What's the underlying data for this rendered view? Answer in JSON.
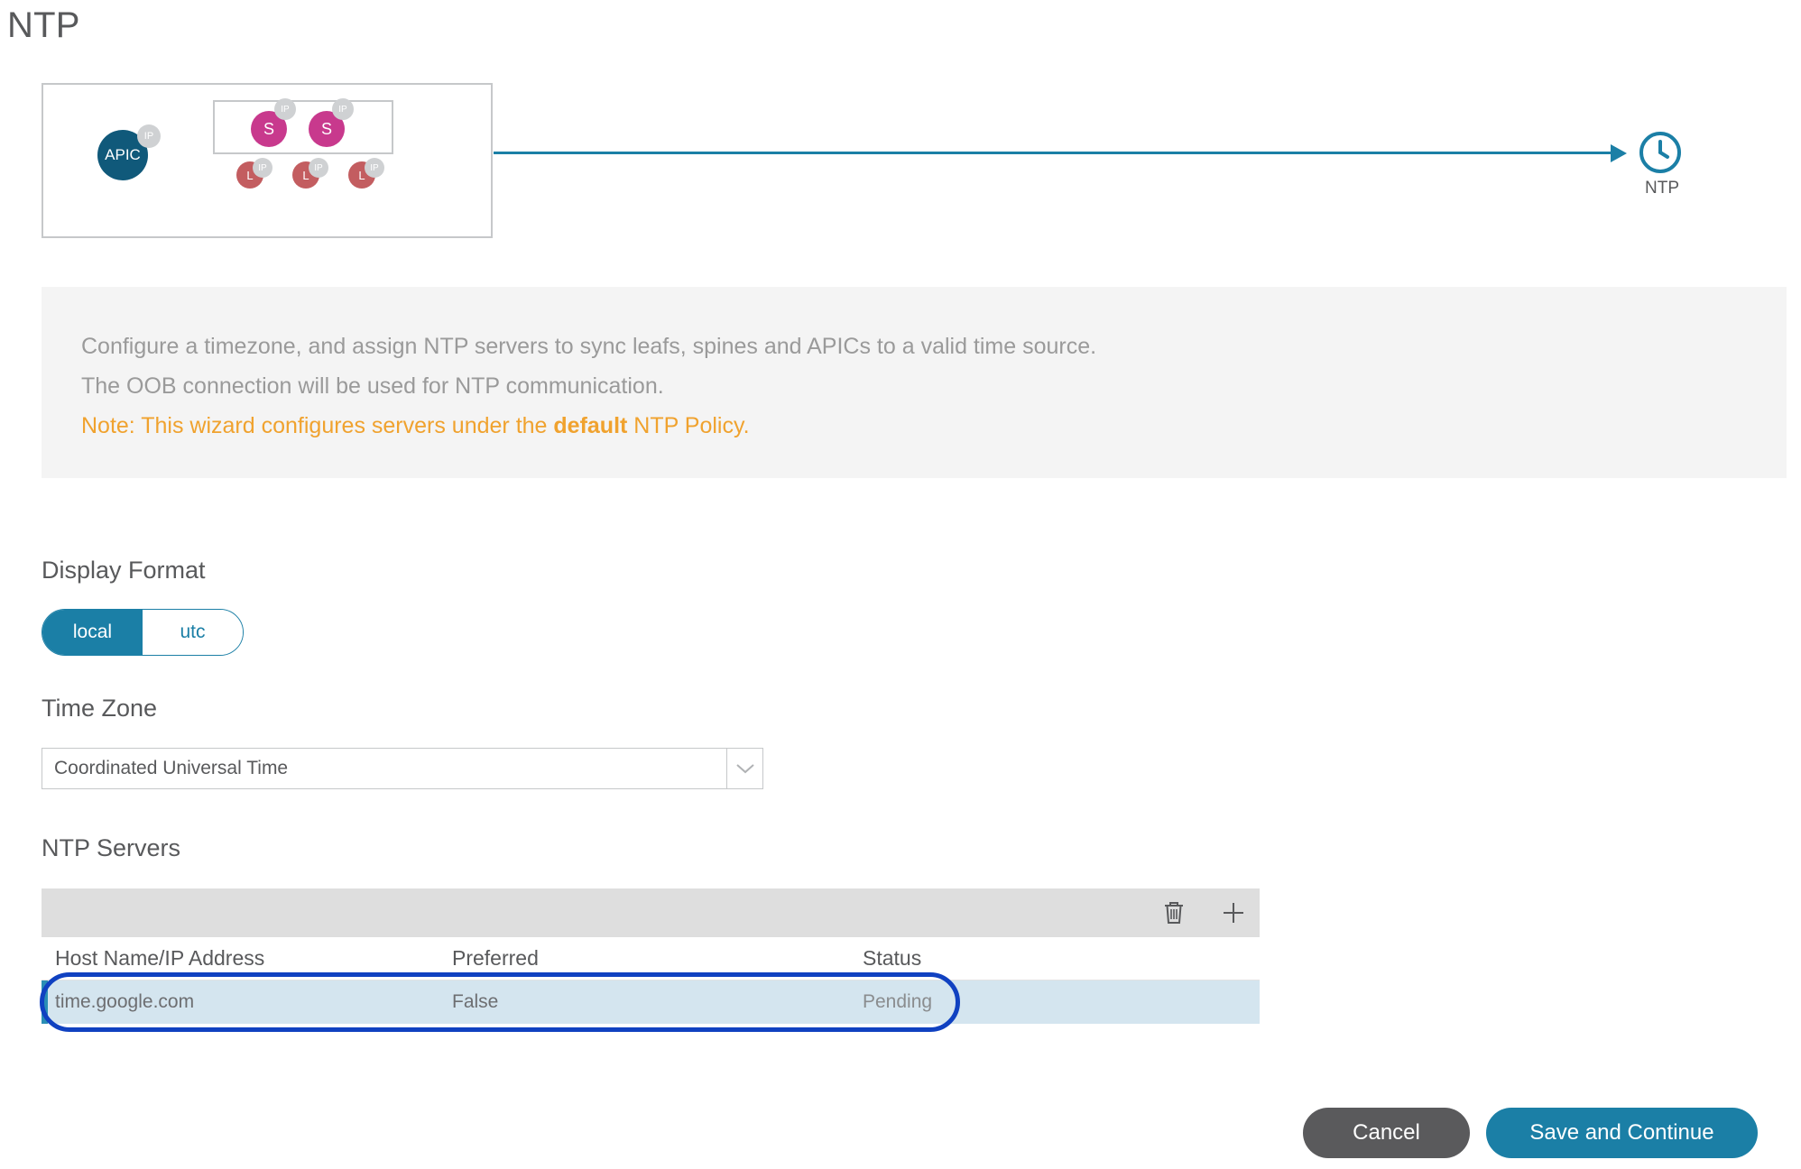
{
  "page": {
    "title": "NTP"
  },
  "topology": {
    "apic": {
      "label": "APIC",
      "badge": "IP",
      "color": "#10597a"
    },
    "spines": [
      {
        "label": "S",
        "badge": "IP",
        "color": "#c8398d"
      },
      {
        "label": "S",
        "badge": "IP",
        "color": "#c8398d"
      }
    ],
    "leafs": [
      {
        "label": "L",
        "badge": "IP",
        "color": "#c35d60"
      },
      {
        "label": "L",
        "badge": "IP",
        "color": "#c35d60"
      },
      {
        "label": "L",
        "badge": "IP",
        "color": "#c35d60"
      }
    ],
    "target": {
      "label": "NTP",
      "icon": "clock-icon",
      "color": "#1b7fa6"
    },
    "arrow_color": "#1b7fa6"
  },
  "info": {
    "line1": "Configure a timezone, and assign NTP servers to sync leafs, spines and APICs to a valid time source.",
    "line2": "The OOB connection will be used for NTP communication.",
    "note_prefix": "Note: This wizard configures servers under the ",
    "note_bold": "default",
    "note_suffix": " NTP Policy.",
    "text_color": "#9a9a9a",
    "note_color": "#f0a22e",
    "background": "#f4f4f4"
  },
  "display_format": {
    "label": "Display Format",
    "selected": "local",
    "options": [
      {
        "value": "local",
        "label": "local",
        "selected": true
      },
      {
        "value": "utc",
        "label": "utc",
        "selected": false
      }
    ],
    "accent_color": "#1b7fa6"
  },
  "time_zone": {
    "label": "Time Zone",
    "value": "Coordinated Universal Time",
    "icon": "chevron-down-icon"
  },
  "ntp_servers": {
    "label": "NTP Servers",
    "toolbar": {
      "delete_icon": "trash-icon",
      "add_icon": "plus-icon"
    },
    "columns": [
      "Host Name/IP Address",
      "Preferred",
      "Status"
    ],
    "rows": [
      {
        "host": "time.google.com",
        "preferred": "False",
        "status": "Pending",
        "selected": true
      }
    ],
    "row_highlight_color": "#1041c1",
    "row_background": "#d4e5ef",
    "row_accent_color": "#2a8eb5"
  },
  "footer": {
    "cancel_label": "Cancel",
    "save_label": "Save and Continue",
    "cancel_color": "#5a5a5c",
    "save_color": "#1b7fa6"
  }
}
